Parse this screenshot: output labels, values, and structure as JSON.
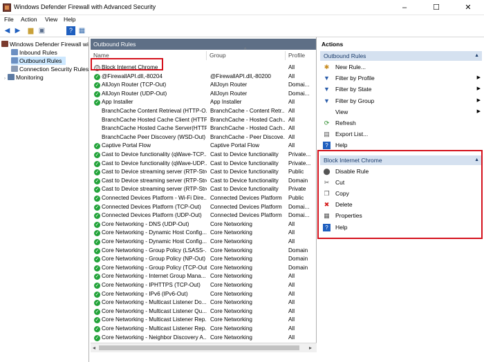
{
  "window": {
    "title": "Windows Defender Firewall with Advanced Security",
    "controls": [
      "–",
      "☐",
      "✕"
    ]
  },
  "menu": [
    "File",
    "Action",
    "View",
    "Help"
  ],
  "toolbar": [
    "back-arrow-icon",
    "forward-arrow-icon",
    "up-folder-icon",
    "show-hide-tree-icon",
    "help-icon",
    "properties-icon"
  ],
  "tree": [
    {
      "label": "Windows Defender Firewall witl",
      "level": 0
    },
    {
      "label": "Inbound Rules",
      "level": 1
    },
    {
      "label": "Outbound Rules",
      "level": 1,
      "selected": true
    },
    {
      "label": "Connection Security Rules",
      "level": 1
    },
    {
      "label": "Monitoring",
      "level": 1
    }
  ],
  "middle": {
    "header": "Outbound Rules",
    "columns": {
      "name": "Name",
      "group": "Group",
      "profile": "Profile"
    },
    "rules": [
      {
        "name": "Block Internet Chrome",
        "group": "",
        "profile": "All",
        "status": "blocked"
      },
      {
        "name": "@FirewallAPI.dll,-80204",
        "group": "@FirewallAPI.dll,-80200",
        "profile": "All",
        "status": "enabled"
      },
      {
        "name": "AllJoyn Router (TCP-Out)",
        "group": "AllJoyn Router",
        "profile": "Domai...",
        "status": "enabled"
      },
      {
        "name": "AllJoyn Router (UDP-Out)",
        "group": "AllJoyn Router",
        "profile": "Domai...",
        "status": "enabled"
      },
      {
        "name": "App Installer",
        "group": "App Installer",
        "profile": "All",
        "status": "enabled"
      },
      {
        "name": "BranchCache Content Retrieval (HTTP-O...",
        "group": "BranchCache - Content Retr...",
        "profile": "All",
        "status": "none"
      },
      {
        "name": "BranchCache Hosted Cache Client (HTTP...",
        "group": "BranchCache - Hosted Cach...",
        "profile": "All",
        "status": "none"
      },
      {
        "name": "BranchCache Hosted Cache Server(HTTP...",
        "group": "BranchCache - Hosted Cach...",
        "profile": "All",
        "status": "none"
      },
      {
        "name": "BranchCache Peer Discovery (WSD-Out)",
        "group": "BranchCache - Peer Discove...",
        "profile": "All",
        "status": "none"
      },
      {
        "name": "Captive Portal Flow",
        "group": "Captive Portal Flow",
        "profile": "All",
        "status": "enabled"
      },
      {
        "name": "Cast to Device functionality (qWave-TCP...",
        "group": "Cast to Device functionality",
        "profile": "Private...",
        "status": "enabled"
      },
      {
        "name": "Cast to Device functionality (qWave-UDP...",
        "group": "Cast to Device functionality",
        "profile": "Private...",
        "status": "enabled"
      },
      {
        "name": "Cast to Device streaming server (RTP-Stre...",
        "group": "Cast to Device functionality",
        "profile": "Public",
        "status": "enabled"
      },
      {
        "name": "Cast to Device streaming server (RTP-Stre...",
        "group": "Cast to Device functionality",
        "profile": "Domain",
        "status": "enabled"
      },
      {
        "name": "Cast to Device streaming server (RTP-Stre...",
        "group": "Cast to Device functionality",
        "profile": "Private",
        "status": "enabled"
      },
      {
        "name": "Connected Devices Platform - Wi-Fi Dire...",
        "group": "Connected Devices Platform",
        "profile": "Public",
        "status": "enabled"
      },
      {
        "name": "Connected Devices Platform (TCP-Out)",
        "group": "Connected Devices Platform",
        "profile": "Domai...",
        "status": "enabled"
      },
      {
        "name": "Connected Devices Platform (UDP-Out)",
        "group": "Connected Devices Platform",
        "profile": "Domai...",
        "status": "enabled"
      },
      {
        "name": "Core Networking - DNS (UDP-Out)",
        "group": "Core Networking",
        "profile": "All",
        "status": "enabled"
      },
      {
        "name": "Core Networking - Dynamic Host Config...",
        "group": "Core Networking",
        "profile": "All",
        "status": "enabled"
      },
      {
        "name": "Core Networking - Dynamic Host Config...",
        "group": "Core Networking",
        "profile": "All",
        "status": "enabled"
      },
      {
        "name": "Core Networking - Group Policy (LSASS-...",
        "group": "Core Networking",
        "profile": "Domain",
        "status": "enabled"
      },
      {
        "name": "Core Networking - Group Policy (NP-Out)",
        "group": "Core Networking",
        "profile": "Domain",
        "status": "enabled"
      },
      {
        "name": "Core Networking - Group Policy (TCP-Out)",
        "group": "Core Networking",
        "profile": "Domain",
        "status": "enabled"
      },
      {
        "name": "Core Networking - Internet Group Mana...",
        "group": "Core Networking",
        "profile": "All",
        "status": "enabled"
      },
      {
        "name": "Core Networking - IPHTTPS (TCP-Out)",
        "group": "Core Networking",
        "profile": "All",
        "status": "enabled"
      },
      {
        "name": "Core Networking - IPv6 (IPv6-Out)",
        "group": "Core Networking",
        "profile": "All",
        "status": "enabled"
      },
      {
        "name": "Core Networking - Multicast Listener Do...",
        "group": "Core Networking",
        "profile": "All",
        "status": "enabled"
      },
      {
        "name": "Core Networking - Multicast Listener Qu...",
        "group": "Core Networking",
        "profile": "All",
        "status": "enabled"
      },
      {
        "name": "Core Networking - Multicast Listener Rep...",
        "group": "Core Networking",
        "profile": "All",
        "status": "enabled"
      },
      {
        "name": "Core Networking - Multicast Listener Rep...",
        "group": "Core Networking",
        "profile": "All",
        "status": "enabled"
      },
      {
        "name": "Core Networking - Neighbor Discovery A...",
        "group": "Core Networking",
        "profile": "All",
        "status": "enabled"
      }
    ]
  },
  "actions": {
    "title": "Actions",
    "sections": [
      {
        "label": "Outbound Rules",
        "items": [
          {
            "label": "New Rule...",
            "icon": "new-rule-icon",
            "glyph": "✱",
            "color": "#c78a1d",
            "arrow": false
          },
          {
            "label": "Filter by Profile",
            "icon": "filter-icon",
            "glyph": "▼",
            "color": "#2a5caa",
            "arrow": true
          },
          {
            "label": "Filter by State",
            "icon": "filter-icon",
            "glyph": "▼",
            "color": "#2a5caa",
            "arrow": true
          },
          {
            "label": "Filter by Group",
            "icon": "filter-icon",
            "glyph": "▼",
            "color": "#2a5caa",
            "arrow": true
          },
          {
            "label": "View",
            "icon": "",
            "glyph": "",
            "color": "#000",
            "arrow": true
          },
          {
            "label": "Refresh",
            "icon": "refresh-icon",
            "glyph": "⟳",
            "color": "#2a8a2a",
            "arrow": false
          },
          {
            "label": "Export List...",
            "icon": "export-icon",
            "glyph": "▤",
            "color": "#555",
            "arrow": false
          },
          {
            "label": "Help",
            "icon": "help-icon",
            "glyph": "?",
            "color": "#1f5fbf",
            "arrow": false
          }
        ]
      },
      {
        "label": "Block Internet Chrome",
        "items": [
          {
            "label": "Disable Rule",
            "icon": "disable-icon",
            "glyph": "⬤",
            "color": "#555",
            "arrow": false
          },
          {
            "label": "Cut",
            "icon": "cut-icon",
            "glyph": "✂",
            "color": "#555",
            "arrow": false
          },
          {
            "label": "Copy",
            "icon": "copy-icon",
            "glyph": "❐",
            "color": "#555",
            "arrow": false
          },
          {
            "label": "Delete",
            "icon": "delete-icon",
            "glyph": "✖",
            "color": "#d41c1c",
            "arrow": false
          },
          {
            "label": "Properties",
            "icon": "properties-icon",
            "glyph": "▦",
            "color": "#555",
            "arrow": false
          },
          {
            "label": "Help",
            "icon": "help-icon",
            "glyph": "?",
            "color": "#1f5fbf",
            "arrow": false
          }
        ]
      }
    ]
  }
}
